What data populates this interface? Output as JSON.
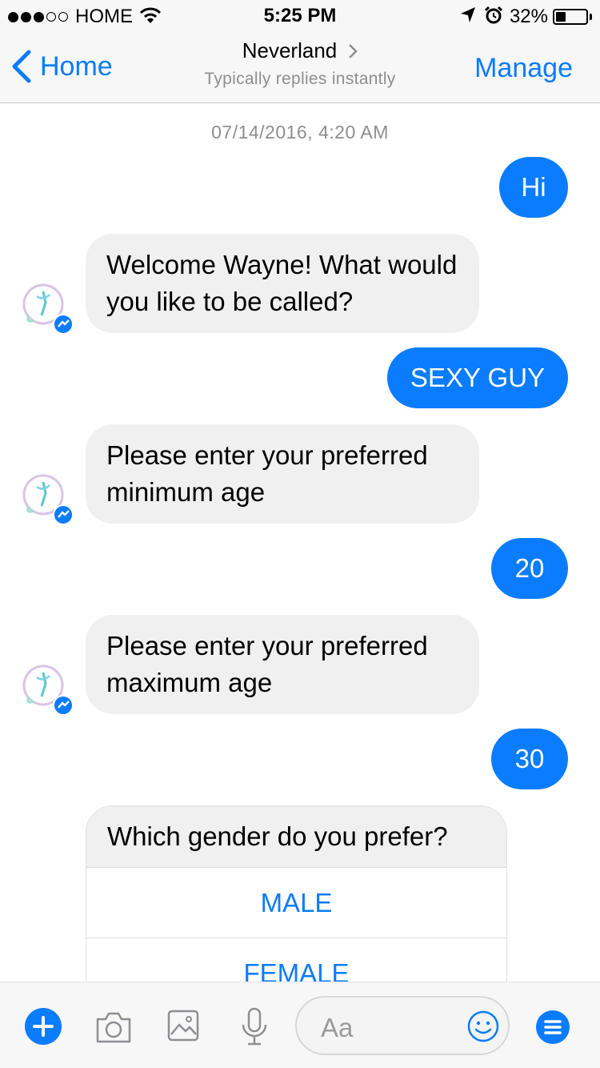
{
  "status_bar": {
    "carrier": "HOME",
    "time": "5:25 PM",
    "battery_percent": "32%",
    "battery_level": 0.32,
    "signal_bars": 3
  },
  "nav": {
    "back_label": "Home",
    "title": "Neverland",
    "subtitle": "Typically replies instantly",
    "manage_label": "Manage"
  },
  "chat": {
    "timestamp": "07/14/2016, 4:20 AM",
    "messages": [
      {
        "from": "me",
        "text": "Hi"
      },
      {
        "from": "bot",
        "text": "Welcome Wayne! What would you like to be called?"
      },
      {
        "from": "me",
        "text": "SEXY GUY"
      },
      {
        "from": "bot",
        "text": "Please enter your preferred minimum age"
      },
      {
        "from": "me",
        "text": "20"
      },
      {
        "from": "bot",
        "text": "Please enter your preferred maximum age"
      },
      {
        "from": "me",
        "text": "30"
      }
    ],
    "quick_reply": {
      "question": "Which gender do you prefer?",
      "options": [
        "MALE",
        "FEMALE"
      ]
    }
  },
  "composer": {
    "placeholder": "Aa",
    "icons": [
      "plus-icon",
      "camera-icon",
      "photo-icon",
      "microphone-icon",
      "emoji-icon",
      "menu-icon"
    ]
  },
  "colors": {
    "accent": "#0a7cff",
    "incoming_bubble": "#f1f0f0",
    "bar_background": "#f7f7f7",
    "muted_text": "#8e8e93"
  }
}
